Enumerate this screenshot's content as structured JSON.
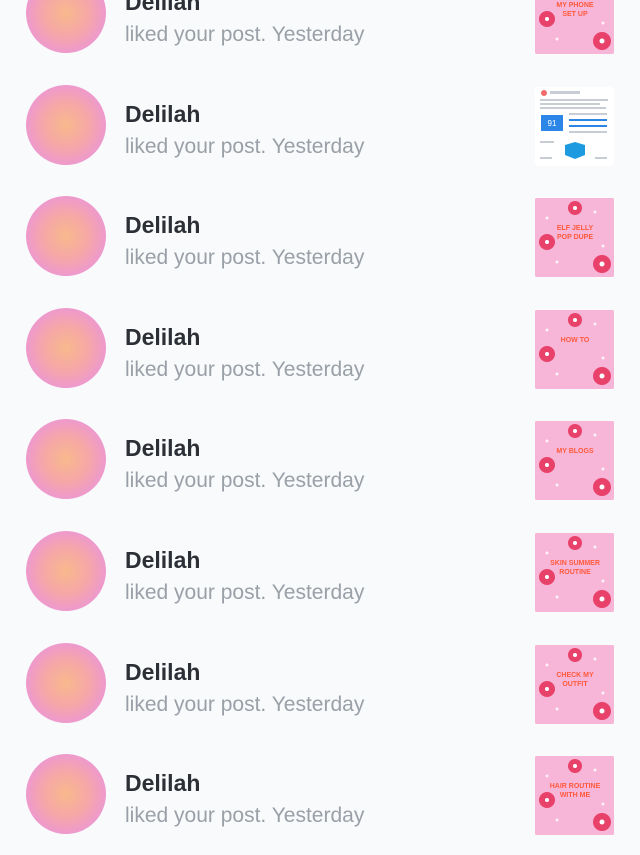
{
  "notifications": [
    {
      "user": "Delilah",
      "action": "liked your post.",
      "time": "Yesterday",
      "thumb_icon": "pink-post-thumbnail",
      "thumb_text": "MY PHONE SET UP"
    },
    {
      "user": "Delilah",
      "action": "liked your post.",
      "time": "Yesterday",
      "thumb_icon": "screenshot-post-thumbnail",
      "thumb_text": "91"
    },
    {
      "user": "Delilah",
      "action": "liked your post.",
      "time": "Yesterday",
      "thumb_icon": "pink-post-thumbnail",
      "thumb_text": "ELF JELLY POP DUPE"
    },
    {
      "user": "Delilah",
      "action": "liked your post.",
      "time": "Yesterday",
      "thumb_icon": "pink-post-thumbnail",
      "thumb_text": "HOW TO"
    },
    {
      "user": "Delilah",
      "action": "liked your post.",
      "time": "Yesterday",
      "thumb_icon": "pink-post-thumbnail",
      "thumb_text": "MY BLOGS"
    },
    {
      "user": "Delilah",
      "action": "liked your post.",
      "time": "Yesterday",
      "thumb_icon": "pink-post-thumbnail",
      "thumb_text": "SKIN SUMMER ROUTINE"
    },
    {
      "user": "Delilah",
      "action": "liked your post.",
      "time": "Yesterday",
      "thumb_icon": "pink-post-thumbnail",
      "thumb_text": "CHECK MY OUTFIT"
    },
    {
      "user": "Delilah",
      "action": "liked your post.",
      "time": "Yesterday",
      "thumb_icon": "pink-post-thumbnail",
      "thumb_text": "HAIR ROUTINE WITH ME"
    }
  ],
  "colors": {
    "background": "#f9fafb",
    "name": "#2c2f36",
    "subtext": "#9aa0a8",
    "thumb_pink": "#f7b6d8",
    "thumb_text": "#ff5a3c"
  }
}
